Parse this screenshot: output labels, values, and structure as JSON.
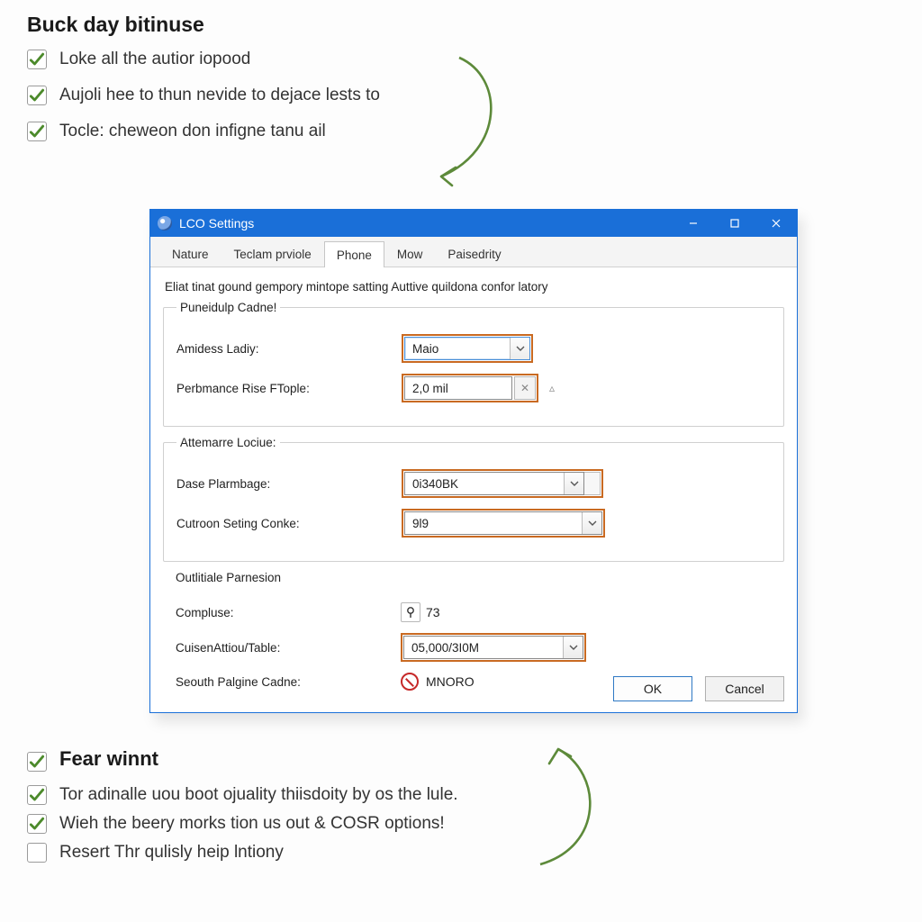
{
  "top": {
    "title": "Buck day bitinuse",
    "items": [
      {
        "checked": true,
        "label": "Loke all the autior iopood"
      },
      {
        "checked": true,
        "label": "Aujoli hee to thun nevide to dejace lests to"
      },
      {
        "checked": true,
        "label": "Tocle: cheweon don infigne tanu ail"
      }
    ]
  },
  "dialog": {
    "title": "LCO Settings",
    "tabs": [
      "Nature",
      "Teclam prviole",
      "Phone",
      "Mow",
      "Paisedrity"
    ],
    "active_tab": 2,
    "description": "Eliat tinat gound gempory mintope satting Auttive quildona confor latory",
    "group1": {
      "legend": "Puneidulp Cadne!",
      "row1_label": "Amidess Ladiy:",
      "row1_value": "Maio",
      "row2_label": "Perbmance Rise FTople:",
      "row2_value": "2,0 mil"
    },
    "group2": {
      "legend": "Attemarre Lociue:",
      "row1_label": "Dase Plarmbage:",
      "row1_value": "0i340BK",
      "row2_label": "Cutroon Seting Conke:",
      "row2_value": "9l9"
    },
    "group3": {
      "legend": "Outlitiale Parnesion",
      "row1_label": "Compluse:",
      "row1_value": "73",
      "row2_label": "CuisenAttiou/Table:",
      "row2_value": "05,000/3I0M",
      "row3_label": "Seouth Palgine Cadne:",
      "row3_value": "MNORO"
    },
    "buttons": {
      "ok": "OK",
      "cancel": "Cancel"
    }
  },
  "bottom": {
    "title": "Fear winnt",
    "items": [
      {
        "checked": true,
        "label": "Tor adinalle uou boot ojuality thiisdoity by os the lule."
      },
      {
        "checked": true,
        "label": "Wieh the beery morks tion us out & COSR options!"
      },
      {
        "checked": false,
        "label": "Resert Thr qulisly heip lntiony"
      }
    ]
  },
  "colors": {
    "highlight": "#c96a22",
    "accent": "#1a6fd8",
    "check": "#4c8a2b"
  }
}
